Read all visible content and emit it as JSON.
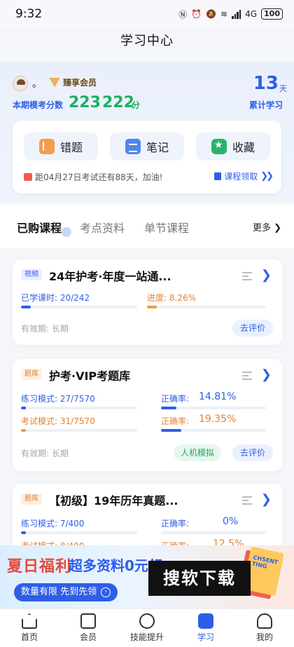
{
  "status_bar": {
    "time": "9:32",
    "network": "4G",
    "battery": "100"
  },
  "header": {
    "title": "学习中心"
  },
  "profile": {
    "username": "。",
    "vip_label": "臻享会员",
    "score_label": "本期模考分数",
    "score_a": "223",
    "score_b": "222",
    "score_unit": "分",
    "days_value": "13",
    "days_unit": "天",
    "days_label": "累计学习"
  },
  "tools": {
    "wrong_label": "错题",
    "notes_label": "笔记",
    "fav_label": "收藏",
    "countdown": "距04月27日考试还有88天，加油!",
    "course_get": "课程领取"
  },
  "tabs": {
    "items": [
      "已购课程",
      "考点资料",
      "单节课程"
    ],
    "more": "更多"
  },
  "courses": [
    {
      "tag": "视频",
      "title": "24年护考·年度一站通...",
      "learned_label": "已学课时: 20/242",
      "learned_fraction": 0.0826,
      "progress_label": "进度: 8.26%",
      "progress_fraction": 0.0826,
      "validity": "有效期: 长期",
      "review": "去评价"
    },
    {
      "tag": "题库",
      "title": "护考·VIP考题库",
      "practice_label": "练习模式: 27/7570",
      "practice_fraction": 0.0036,
      "exam_label": "考试模式: 31/7570",
      "exam_fraction": 0.0041,
      "acc_label": "正确率:",
      "acc1": "14.81%",
      "acc1_fraction": 0.1481,
      "acc2": "19.35%",
      "acc2_fraction": 0.1935,
      "validity": "有效期: 长期",
      "ai_mock": "人机模拟",
      "review": "去评价"
    },
    {
      "tag": "题库",
      "title": "【初级】19年历年真题...",
      "practice_label": "练习模式: 7/400",
      "practice_fraction": 0.0175,
      "exam_label": "考试模式: 8/400",
      "acc_label": "正确率:",
      "acc1": "0%",
      "acc2": "12.5%"
    }
  ],
  "banner": {
    "title": "夏日福利",
    "subtitle": "超多资料0元领",
    "button": "数量有限 先到先领",
    "overlay": "搜软下载",
    "book_text": "CHSENT TING"
  },
  "tab_bar": {
    "items": [
      "首页",
      "会员",
      "技能提升",
      "学习",
      "我的"
    ]
  },
  "colors": {
    "accent": "#2e5ee8",
    "score": "#19b265",
    "orange": "#e5832f"
  }
}
